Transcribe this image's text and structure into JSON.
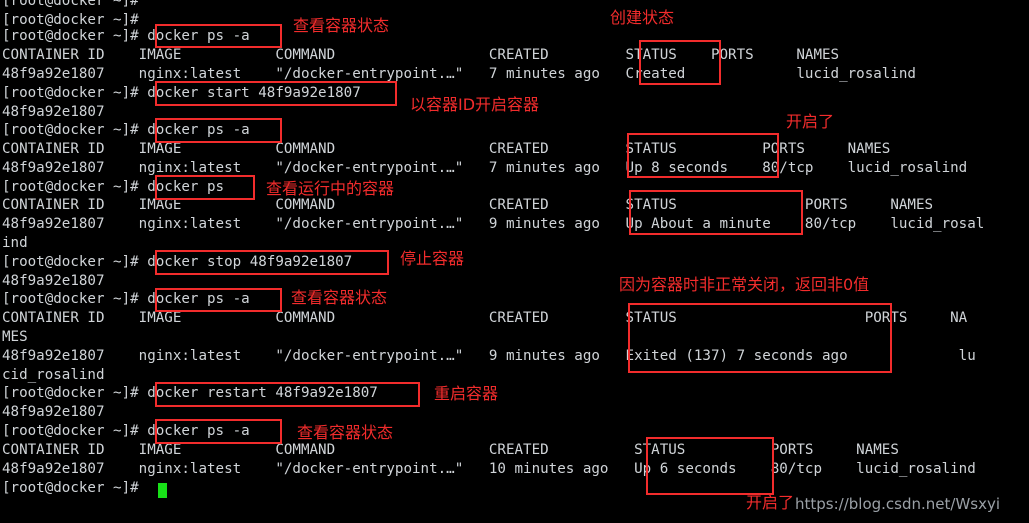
{
  "terminal": {
    "prompt": "[root@docker ~]#",
    "cursor_color": "#18e018",
    "text_color": "#d0d4d8",
    "background": "#000000",
    "lines": [
      {
        "id": "l0",
        "text": "[root@docker ~]#"
      },
      {
        "id": "l1",
        "text": "[root@docker ~]#"
      },
      {
        "id": "l2",
        "text": "[root@docker ~]# docker ps -a"
      },
      {
        "id": "l3",
        "text": "CONTAINER ID    IMAGE           COMMAND                  CREATED         STATUS    PORTS     NAMES"
      },
      {
        "id": "l4",
        "text": "48f9a92e1807    nginx:latest    \"/docker-entrypoint.…\"   7 minutes ago   Created             lucid_rosalind"
      },
      {
        "id": "l5",
        "text": "[root@docker ~]# docker start 48f9a92e1807"
      },
      {
        "id": "l6",
        "text": "48f9a92e1807"
      },
      {
        "id": "l7",
        "text": "[root@docker ~]# docker ps -a"
      },
      {
        "id": "l8",
        "text": "CONTAINER ID    IMAGE           COMMAND                  CREATED         STATUS          PORTS     NAMES"
      },
      {
        "id": "l9",
        "text": "48f9a92e1807    nginx:latest    \"/docker-entrypoint.…\"   7 minutes ago   Up 8 seconds    80/tcp    lucid_rosalind"
      },
      {
        "id": "l10",
        "text": "[root@docker ~]# docker ps"
      },
      {
        "id": "l11",
        "text": "CONTAINER ID    IMAGE           COMMAND                  CREATED         STATUS               PORTS     NAMES"
      },
      {
        "id": "l12",
        "text": "48f9a92e1807    nginx:latest    \"/docker-entrypoint.…\"   9 minutes ago   Up About a minute    80/tcp    lucid_rosal"
      },
      {
        "id": "l13",
        "text": "ind"
      },
      {
        "id": "l14",
        "text": "[root@docker ~]# docker stop 48f9a92e1807"
      },
      {
        "id": "l15",
        "text": "48f9a92e1807"
      },
      {
        "id": "l16",
        "text": "[root@docker ~]# docker ps -a"
      },
      {
        "id": "l17",
        "text": "CONTAINER ID    IMAGE           COMMAND                  CREATED         STATUS                      PORTS     NA"
      },
      {
        "id": "l18",
        "text": "MES"
      },
      {
        "id": "l19",
        "text": "48f9a92e1807    nginx:latest    \"/docker-entrypoint.…\"   9 minutes ago   Exited (137) 7 seconds ago             lu"
      },
      {
        "id": "l20",
        "text": "cid_rosalind"
      },
      {
        "id": "l21",
        "text": "[root@docker ~]# docker restart 48f9a92e1807"
      },
      {
        "id": "l22",
        "text": "48f9a92e1807"
      },
      {
        "id": "l23",
        "text": "[root@docker ~]# docker ps -a"
      },
      {
        "id": "l24",
        "text": "CONTAINER ID    IMAGE           COMMAND                  CREATED          STATUS          PORTS     NAMES"
      },
      {
        "id": "l25",
        "text": "48f9a92e1807    nginx:latest    \"/docker-entrypoint.…\"   10 minutes ago   Up 6 seconds    80/tcp    lucid_rosalind"
      },
      {
        "id": "l26",
        "text": "[root@docker ~]#"
      }
    ]
  },
  "commands": [
    {
      "id": "cmd1",
      "text": "docker ps -a"
    },
    {
      "id": "cmd2",
      "text": "docker start 48f9a92e1807"
    },
    {
      "id": "cmd3",
      "text": "docker ps -a"
    },
    {
      "id": "cmd4",
      "text": "docker ps"
    },
    {
      "id": "cmd5",
      "text": "docker stop 48f9a92e1807"
    },
    {
      "id": "cmd6",
      "text": "docker ps -a"
    },
    {
      "id": "cmd7",
      "text": "docker restart 48f9a92e1807"
    },
    {
      "id": "cmd8",
      "text": "docker ps -a"
    }
  ],
  "annotations": {
    "accent_color": "#f22c2c",
    "labels": [
      {
        "id": "a1",
        "text": "查看容器状态"
      },
      {
        "id": "a2",
        "text": "创建状态"
      },
      {
        "id": "a3",
        "text": "以容器ID开启容器"
      },
      {
        "id": "a4",
        "text": "开启了"
      },
      {
        "id": "a5",
        "text": "查看运行中的容器"
      },
      {
        "id": "a6",
        "text": "停止容器"
      },
      {
        "id": "a7",
        "text": "查看容器状态"
      },
      {
        "id": "a8",
        "text": "因为容器时非正常关闭，返回非0值"
      },
      {
        "id": "a9",
        "text": "重启容器"
      },
      {
        "id": "a10",
        "text": "查看容器状态"
      },
      {
        "id": "a11",
        "text": "开启了"
      }
    ]
  },
  "statuses": {
    "created": "Created",
    "up8": "Up 8 seconds",
    "up_about_minute": "Up About a minute",
    "exited": "Exited (137) 7 seconds ago",
    "up6": "Up 6 seconds"
  },
  "container": {
    "id": "48f9a92e1807",
    "image": "nginx:latest",
    "command": "\"/docker-entrypoint.…\"",
    "ports": "80/tcp",
    "name": "lucid_rosalind"
  },
  "watermark": {
    "text": "https://blog.csdn.net/Wsxyi"
  }
}
